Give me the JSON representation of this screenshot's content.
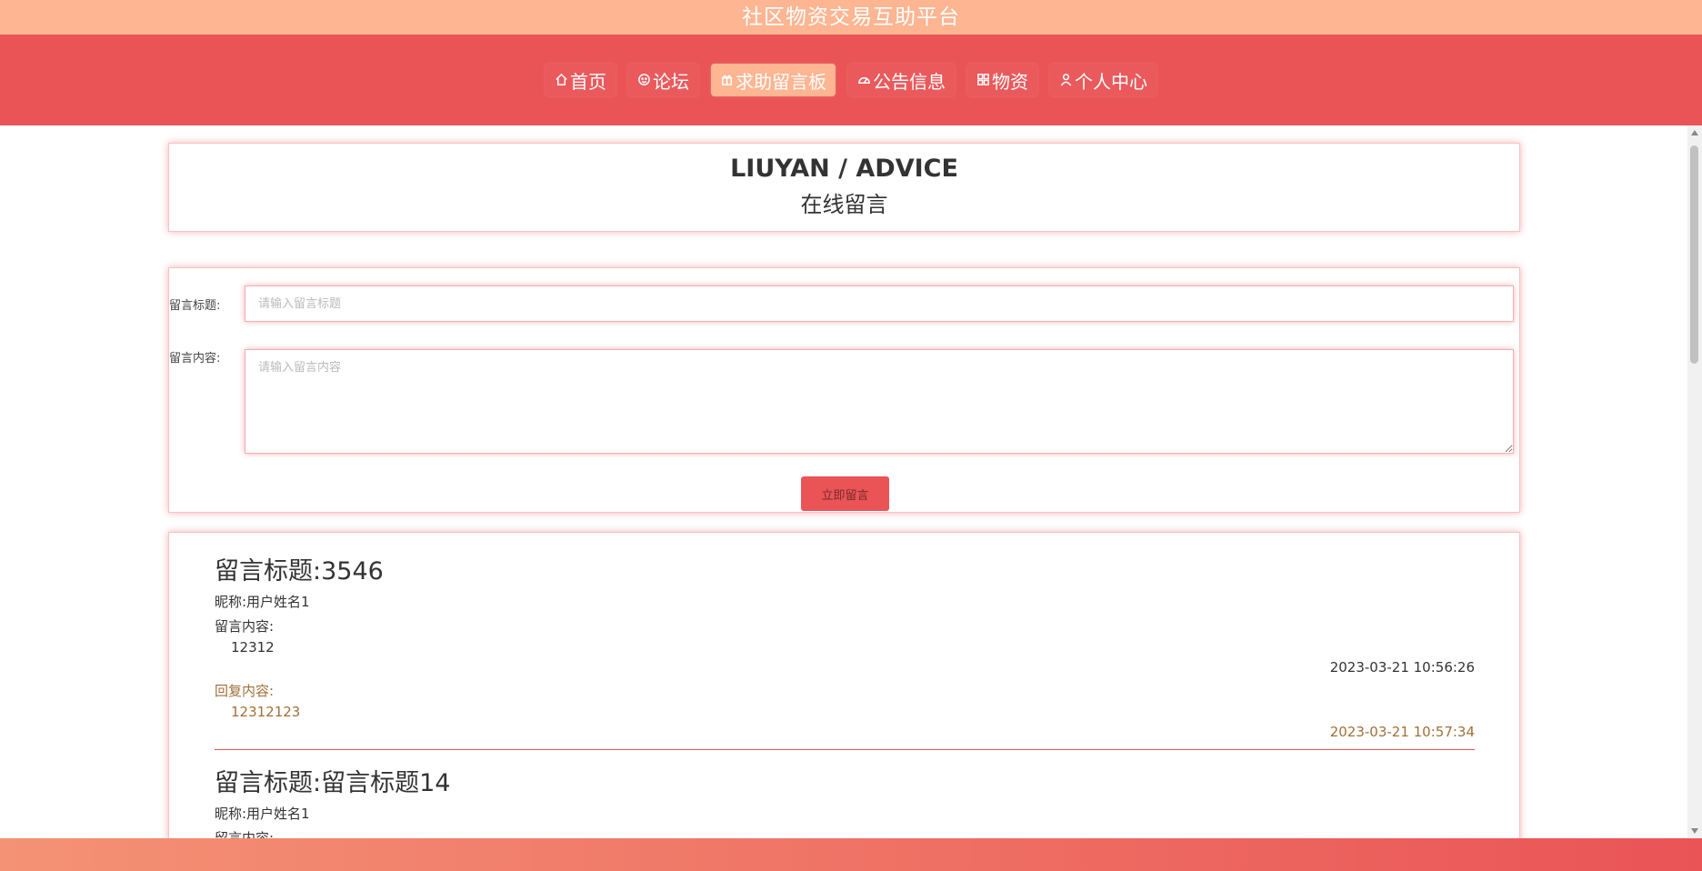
{
  "site": {
    "title": "社区物资交易互助平台"
  },
  "nav": {
    "items": [
      {
        "label": "首页",
        "icon": "home-icon"
      },
      {
        "label": "论坛",
        "icon": "smile-icon"
      },
      {
        "label": "求助留言板",
        "icon": "gift-icon",
        "active": true
      },
      {
        "label": "公告信息",
        "icon": "dashboard-icon"
      },
      {
        "label": "物资",
        "icon": "grid-icon"
      },
      {
        "label": "个人中心",
        "icon": "user-icon"
      }
    ]
  },
  "header": {
    "title_en": "LIUYAN / ADVICE",
    "title_cn": "在线留言"
  },
  "form": {
    "title_label": "留言标题:",
    "title_placeholder": "请输入留言标题",
    "content_label": "留言内容:",
    "content_placeholder": "请输入留言内容",
    "submit_label": "立即留言"
  },
  "messages": [
    {
      "title": "留言标题:3546",
      "nickname": "昵称:用户姓名1",
      "content_label": "留言内容:",
      "content": "12312",
      "time": "2023-03-21 10:56:26",
      "reply_label": "回复内容:",
      "reply": "12312123",
      "reply_time": "2023-03-21 10:57:34"
    },
    {
      "title": "留言标题:留言标题14",
      "nickname": "昵称:用户姓名1",
      "content_label": "留言内容:"
    }
  ],
  "colors": {
    "topbar": "#fdb592",
    "navbar": "#ea5456",
    "active_tab": "#fdb592",
    "reply_text": "#a0703a"
  }
}
